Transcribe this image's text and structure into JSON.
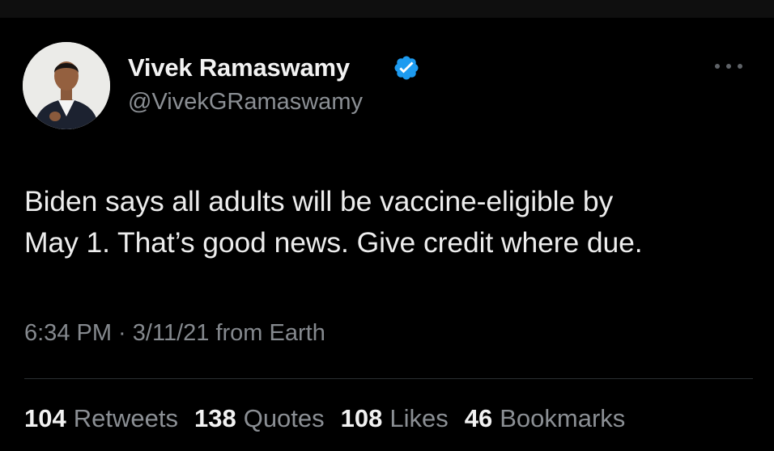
{
  "tweet": {
    "author": {
      "display_name": "Vivek Ramaswamy",
      "handle": "@VivekGRamaswamy",
      "verified": true,
      "verified_color": "#1d9bf0"
    },
    "text_lines": [
      "Biden says all adults will be vaccine-eligible by",
      "May 1. That’s good news. Give credit where due."
    ],
    "time": "6:34 PM",
    "separator": " · ",
    "date": "3/11/21",
    "source": " from Earth",
    "stats": {
      "retweets": {
        "count": "104",
        "label": "Retweets"
      },
      "quotes": {
        "count": "138",
        "label": "Quotes"
      },
      "likes": {
        "count": "108",
        "label": "Likes"
      },
      "bookmarks": {
        "count": "46",
        "label": "Bookmarks"
      }
    }
  },
  "icons": {
    "verified": "verified-badge-icon",
    "more": "more-options-icon"
  },
  "colors": {
    "background": "#000000",
    "text_primary": "#e7e9ea",
    "text_secondary": "#8b8f94",
    "divider": "#2b2e31"
  }
}
